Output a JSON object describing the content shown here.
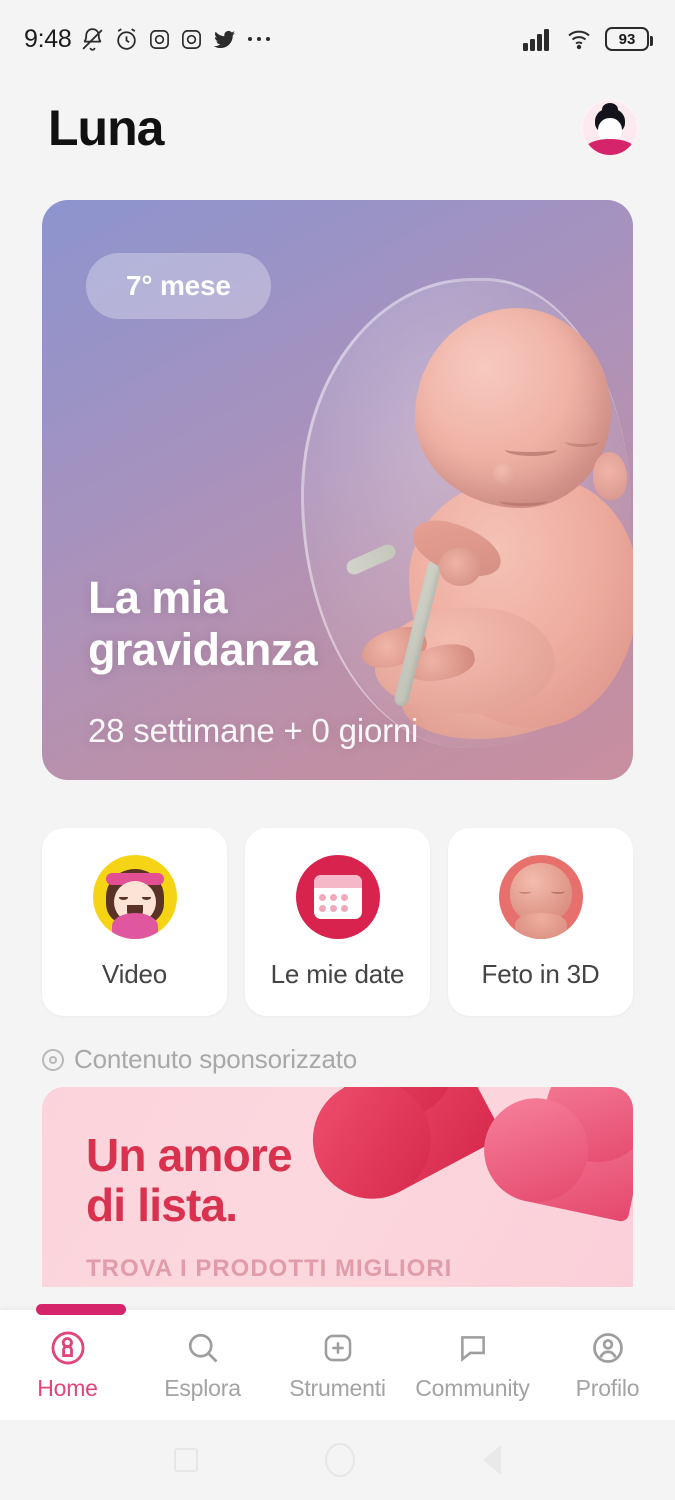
{
  "statusbar": {
    "time": "9:48",
    "battery_level": "93",
    "icons": [
      "bell-muted-icon",
      "alarm-clock-icon",
      "instagram-icon",
      "instagram-icon",
      "twitter-icon",
      "more-dots-icon"
    ],
    "right_icons": [
      "signal-bars-icon",
      "wifi-icon",
      "battery-icon"
    ]
  },
  "header": {
    "app_title": "Luna",
    "avatar_name": "user-avatar"
  },
  "hero": {
    "badge": "7° mese",
    "title_line1": "La mia",
    "title_line2": "gravidanza",
    "subtitle": "28 settimane + 0 giorni",
    "illustration": "fetus-in-amniotic-sac"
  },
  "quick_actions": [
    {
      "label": "Video",
      "icon": "video-woman-icon",
      "color": "#f5d416"
    },
    {
      "label": "Le mie date",
      "icon": "calendar-icon",
      "color": "#d8234e"
    },
    {
      "label": "Feto in 3D",
      "icon": "fetus-3d-icon",
      "color": "#e8706c"
    }
  ],
  "sponsored": {
    "label": "Contenuto sponsorizzato",
    "icon": "target-icon"
  },
  "ad": {
    "title_line1": "Un amore",
    "title_line2": "di lista.",
    "subtitle": "TROVA I PRODOTTI MIGLIORI",
    "accent_color": "#d8324f"
  },
  "bottom_nav": {
    "active_color": "#e0457b",
    "items": [
      {
        "label": "Home",
        "icon": "home-logo-icon",
        "active": true
      },
      {
        "label": "Esplora",
        "icon": "search-icon",
        "active": false
      },
      {
        "label": "Strumenti",
        "icon": "plus-square-icon",
        "active": false
      },
      {
        "label": "Community",
        "icon": "chat-bubble-icon",
        "active": false
      },
      {
        "label": "Profilo",
        "icon": "person-circle-icon",
        "active": false
      }
    ]
  },
  "android_nav": {
    "items": [
      "recents-square-icon",
      "home-circle-icon",
      "back-triangle-icon"
    ]
  }
}
